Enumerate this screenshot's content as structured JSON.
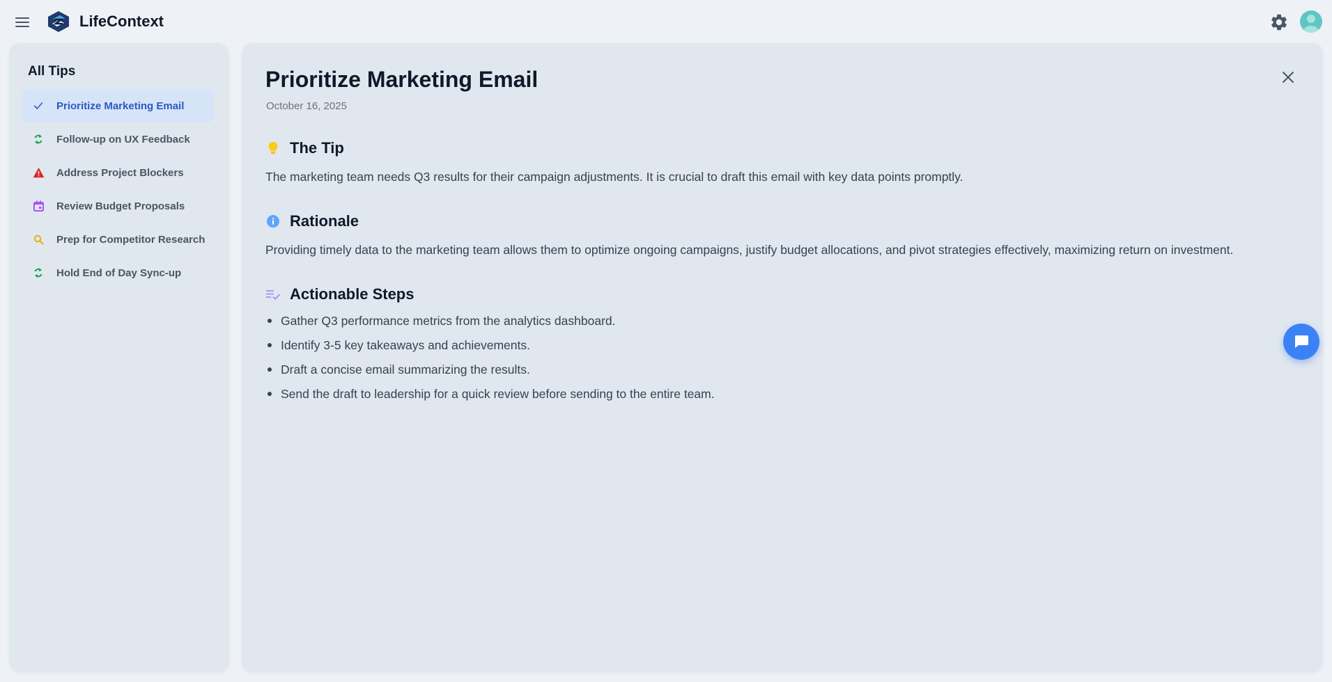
{
  "header": {
    "app_title": "LifeContext",
    "icons": [
      "menu-icon",
      "logo-icon",
      "gear-icon",
      "avatar-icon"
    ]
  },
  "sidebar": {
    "title": "All Tips",
    "items": [
      {
        "label": "Prioritize Marketing Email",
        "icon": "check-icon",
        "color": "#2b59c3",
        "active": true
      },
      {
        "label": "Follow-up on UX Feedback",
        "icon": "sync-icon",
        "color": "#16a34a",
        "active": false
      },
      {
        "label": "Address Project Blockers",
        "icon": "warning-icon",
        "color": "#dc2626",
        "active": false
      },
      {
        "label": "Review Budget Proposals",
        "icon": "calendar-icon",
        "color": "#a855f7",
        "active": false
      },
      {
        "label": "Prep for Competitor Research",
        "icon": "search-icon",
        "color": "#eab308",
        "active": false
      },
      {
        "label": "Hold End of Day Sync-up",
        "icon": "sync-icon",
        "color": "#16a34a",
        "active": false
      }
    ]
  },
  "detail": {
    "title": "Prioritize Marketing Email",
    "date": "October 16, 2025",
    "tip": {
      "heading": "The Tip",
      "icon": "lightbulb-icon",
      "body": "The marketing team needs Q3 results for their campaign adjustments. It is crucial to draft this email with key data points promptly."
    },
    "rationale": {
      "heading": "Rationale",
      "icon": "info-icon",
      "body": "Providing timely data to the marketing team allows them to optimize ongoing campaigns, justify budget allocations, and pivot strategies effectively, maximizing return on investment."
    },
    "steps": {
      "heading": "Actionable Steps",
      "icon": "checklist-icon",
      "items": [
        "Gather Q3 performance metrics from the analytics dashboard.",
        "Identify 3-5 key takeaways and achievements.",
        "Draft a concise email summarizing the results.",
        "Send the draft to leadership for a quick review before sending to the entire team."
      ]
    }
  },
  "colors": {
    "background": "#eef2f7",
    "panel": "#e1e7ef",
    "accent": "#3b82f6",
    "active_item_bg": "#d6e4f8",
    "active_item_text": "#2b59c3"
  }
}
